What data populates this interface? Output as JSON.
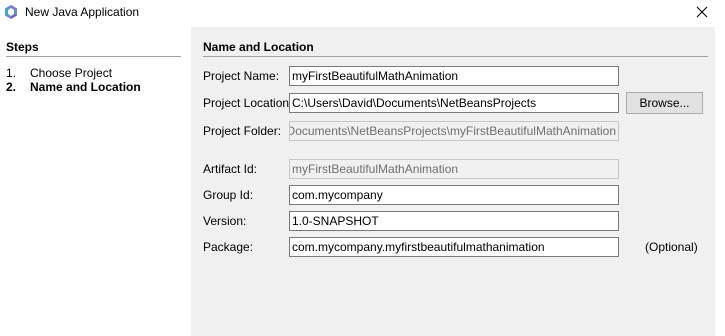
{
  "window": {
    "title": "New Java Application",
    "close_icon": "close-icon",
    "app_icon": "netbeans-logo-icon"
  },
  "steps": {
    "header": "Steps",
    "items": [
      {
        "number": "1.",
        "label": "Choose Project",
        "current": false
      },
      {
        "number": "2.",
        "label": "Name and Location",
        "current": true
      }
    ]
  },
  "form": {
    "header": "Name and Location",
    "project_name": {
      "label": "Project Name:",
      "value": "myFirstBeautifulMathAnimation"
    },
    "project_location": {
      "label": "Project Location:",
      "value": "C:\\Users\\David\\Documents\\NetBeansProjects"
    },
    "browse_label": "Browse...",
    "project_folder": {
      "label": "Project Folder:",
      "value": "C:\\Users\\David\\Documents\\NetBeansProjects\\myFirstBeautifulMathAnimation"
    },
    "artifact_id": {
      "label": "Artifact Id:",
      "value": "myFirstBeautifulMathAnimation"
    },
    "group_id": {
      "label": "Group Id:",
      "value": "com.mycompany"
    },
    "version": {
      "label": "Version:",
      "value": "1.0-SNAPSHOT"
    },
    "package": {
      "label": "Package:",
      "value": "com.mycompany.myfirstbeautifulmathanimation"
    },
    "optional_label": "(Optional)"
  },
  "colors": {
    "content_background": "#f0f0f0",
    "disabled_text": "#707070"
  }
}
